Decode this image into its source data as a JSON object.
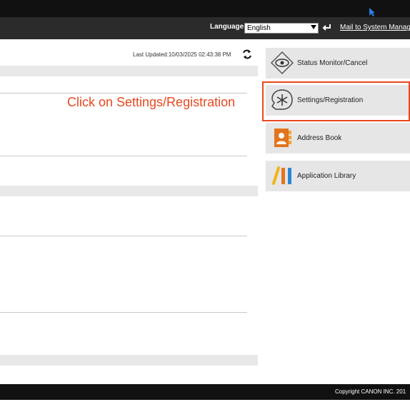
{
  "header": {
    "language_label": "Language:",
    "language_value": "English",
    "mail_link": "Mail to System Manage"
  },
  "status": {
    "last_updated": "Last Updated:10/03/2025 02:43:38 PM"
  },
  "annotation": {
    "text": "Click on Settings/Registration",
    "color": "#e8481f"
  },
  "menu": {
    "items": [
      {
        "label": "Status Monitor/Cancel",
        "icon": "eye-icon"
      },
      {
        "label": "Settings/Registration",
        "icon": "settings-star-icon"
      },
      {
        "label": "Address Book",
        "icon": "address-book-icon"
      },
      {
        "label": "Application Library",
        "icon": "application-library-icon"
      }
    ]
  },
  "footer": {
    "copyright": "Copyright CANON INC. 201"
  },
  "colors": {
    "header_bg": "#2b2b2b",
    "topbar_bg": "#111111",
    "highlight": "#e8481f",
    "menu_bg": "#e6e6e6"
  }
}
